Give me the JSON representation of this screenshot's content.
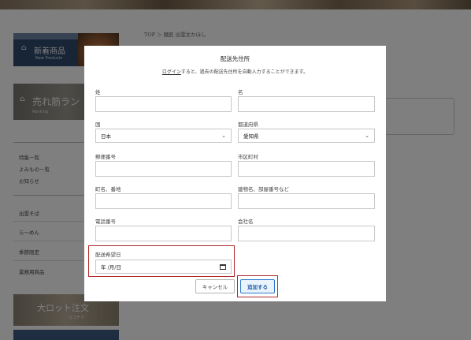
{
  "background": {
    "breadcrumb": "TOP ＞ 麺匠 出雲太かほし",
    "banners": {
      "new_title": "新着商品",
      "new_sub": "New Products",
      "rank_title": "売れ筋ラン",
      "rank_sub": "Ranking"
    },
    "side_links": [
      "特集一覧",
      "よみもの一覧",
      "お知らせ"
    ],
    "categories": [
      "出雲そば",
      "ら～めん",
      "季節限定",
      "業務用商品"
    ],
    "lot_banner": {
      "title": "大ロット注文",
      "sub": "はコチラ"
    }
  },
  "modal": {
    "title": "配送先住所",
    "note_link": "ログイン",
    "note_rest": "すると、過去の配送先住所を自動入力することができます。",
    "fields": {
      "last_name": "姓",
      "first_name": "名",
      "country": "国",
      "country_value": "日本",
      "prefecture": "都道府県",
      "prefecture_value": "愛知県",
      "postal_code": "郵便番号",
      "city": "市区町村",
      "street": "町名、番地",
      "building": "建物名、部屋番号など",
      "phone": "電話番号",
      "company": "会社名",
      "delivery_date": "配送希望日",
      "date_placeholder": "年 /月/日"
    },
    "buttons": {
      "cancel": "キャンセル",
      "add": "追加する"
    }
  },
  "colors": {
    "overlay": "rgba(0,0,0,0.5)",
    "highlight": "#b02a2a",
    "add_button_border": "#2a78c9"
  }
}
